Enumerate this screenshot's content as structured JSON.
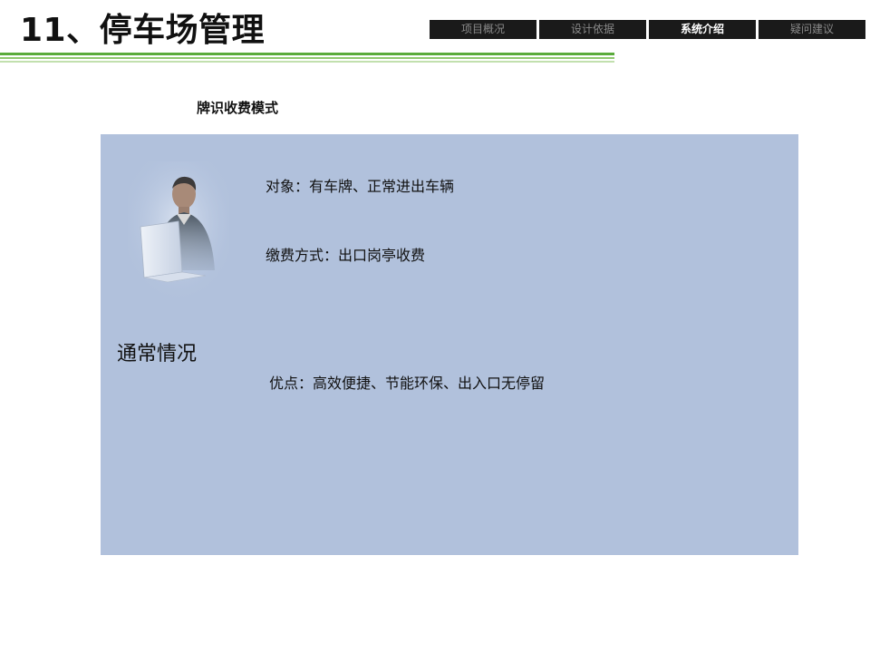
{
  "slide": {
    "title": "11、停车场管理",
    "subtitle": "牌识收费模式"
  },
  "nav": {
    "tabs": [
      {
        "label": "项目概况",
        "active": false
      },
      {
        "label": "设计依据",
        "active": false
      },
      {
        "label": "系统介绍",
        "active": true
      },
      {
        "label": "疑问建议",
        "active": false
      }
    ]
  },
  "panel": {
    "heading": "通常情况",
    "object_text": "对象：有车牌、正常进出车辆",
    "payment_text": "缴费方式：出口岗亭收费",
    "advantage_text": "优点：高效便捷、节能环保、出入口无停留"
  },
  "colors": {
    "panel_bg": "#b1c1dc",
    "nav_bg": "#1a1a1a",
    "accent_green": "#5aab3b"
  }
}
